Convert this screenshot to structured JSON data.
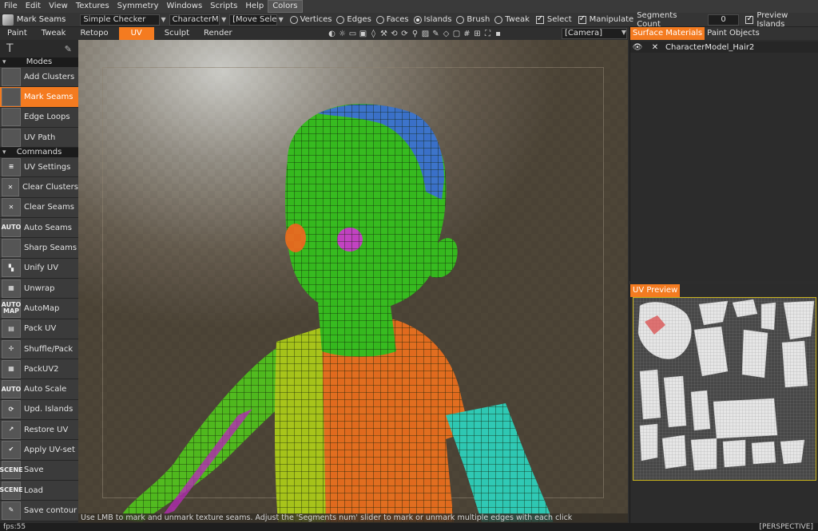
{
  "menu": {
    "items": [
      "File",
      "Edit",
      "View",
      "Textures",
      "Symmetry",
      "Windows",
      "Scripts",
      "Help",
      "Colors"
    ],
    "active_index": 8
  },
  "options": {
    "tool_label": "Mark Seams",
    "shader_combo": "Simple Checker",
    "object_combo": "CharacterMo",
    "transform_combo": "[Move Select",
    "modes": [
      {
        "label": "Vertices",
        "selected": false
      },
      {
        "label": "Edges",
        "selected": false
      },
      {
        "label": "Faces",
        "selected": false
      },
      {
        "label": "Islands",
        "selected": true
      },
      {
        "label": "Brush",
        "selected": false
      },
      {
        "label": "Tweak",
        "selected": false
      }
    ],
    "select_label": "Select",
    "manipulate_label": "Manipulate",
    "segments_label": "Segments Count",
    "segments_value": "0",
    "preview_islands_label": "Preview Islands"
  },
  "rooms": {
    "tabs": [
      "Paint",
      "Tweak",
      "Retopo",
      "UV",
      "Sculpt",
      "Render"
    ],
    "active_index": 3,
    "camera_combo": "[Camera]"
  },
  "toolbar_icons": [
    "view-icon",
    "light-icon",
    "frame-icon",
    "image-icon",
    "drop-icon",
    "tool-icon",
    "loop-icon",
    "refresh-icon",
    "zoom-icon",
    "picture-icon",
    "pen-icon",
    "grid-icon",
    "cube-icon",
    "mesh-icon",
    "snap-icon",
    "fullscreen-icon",
    "screenshot-icon"
  ],
  "left_panel": {
    "modes_header": "Modes",
    "modes": [
      {
        "label": "Add Clusters",
        "icon": "cube-icon",
        "glyph": ""
      },
      {
        "label": "Mark Seams",
        "icon": "cube-seam-icon",
        "glyph": "",
        "active": true
      },
      {
        "label": "Edge Loops",
        "icon": "edge-loop-icon",
        "glyph": ""
      },
      {
        "label": "UV Path",
        "icon": "uv-path-icon",
        "glyph": ""
      }
    ],
    "commands_header": "Commands",
    "commands": [
      {
        "label": "UV Settings",
        "icon": "settings-icon",
        "glyph": "≡"
      },
      {
        "label": "Clear Clusters",
        "icon": "clear-icon",
        "glyph": "✕"
      },
      {
        "label": "Clear Seams",
        "icon": "clear-icon",
        "glyph": "✕"
      },
      {
        "label": "Auto Seams",
        "icon": "auto-icon",
        "glyph": "AUTO"
      },
      {
        "label": "Sharp Seams",
        "icon": "cube-icon",
        "glyph": ""
      },
      {
        "label": "Unify UV",
        "icon": "unify-icon",
        "glyph": "▚"
      },
      {
        "label": "Unwrap",
        "icon": "grid-icon",
        "glyph": "▦"
      },
      {
        "label": "AutoMap",
        "icon": "automap-icon",
        "glyph": "AUTO MAP"
      },
      {
        "label": "Pack UV",
        "icon": "pack-icon",
        "glyph": "▤"
      },
      {
        "label": "Shuffle/Pack",
        "icon": "shuffle-icon",
        "glyph": "✢"
      },
      {
        "label": "PackUV2",
        "icon": "pack-icon",
        "glyph": "▦"
      },
      {
        "label": "Auto Scale",
        "icon": "auto-scale-icon",
        "glyph": "AUTO"
      },
      {
        "label": "Upd. Islands",
        "icon": "refresh-icon",
        "glyph": "⟳"
      },
      {
        "label": "Restore UV",
        "icon": "restore-icon",
        "glyph": "↗"
      },
      {
        "label": "Apply UV-set",
        "icon": "check-icon",
        "glyph": "✔"
      },
      {
        "label": "Save",
        "icon": "scene-save-icon",
        "glyph": "SCENE"
      },
      {
        "label": "Load",
        "icon": "scene-load-icon",
        "glyph": "SCENE"
      },
      {
        "label": "Save contour",
        "icon": "contour-icon",
        "glyph": "✎"
      }
    ]
  },
  "viewport": {
    "hint": "Use LMB to mark and unmark texture seams. Adjust the 'Segments num' slider to mark or unmark multiple edges with each click"
  },
  "status": {
    "fps": "fps:55",
    "projection": "[PERSPECTIVE]"
  },
  "right_panel": {
    "tabs": [
      "Surface Materials",
      "Paint Objects"
    ],
    "active_index": 0,
    "layer_name": "CharacterModel_Hair2",
    "uv_preview_tab": "UV Preview"
  },
  "colors": {
    "accent": "#f47b20",
    "head_green": "#35b81e",
    "head_blue": "#3a70c8",
    "torso_yellow": "#a5c21a",
    "torso_orange": "#e06a1e",
    "arm_cyan": "#2ec7b2",
    "arm_green": "#4fb81e",
    "uv_highlight": "#c8b21e"
  }
}
